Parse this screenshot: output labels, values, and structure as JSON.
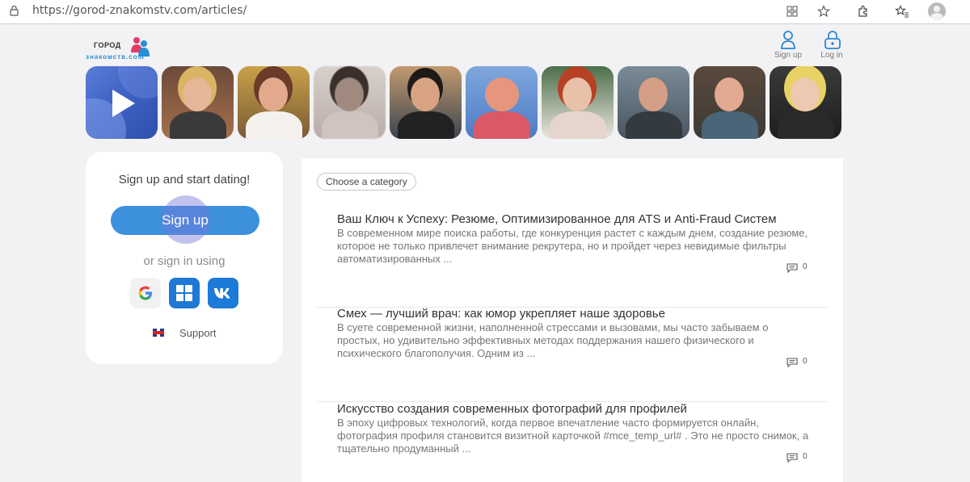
{
  "browser": {
    "url": "https://gorod-znakomstv.com/articles/"
  },
  "header": {
    "logo_top": "ГОРОД",
    "logo_bottom": "знакомств.com",
    "signup_label": "Sign up",
    "login_label": "Log in"
  },
  "sidebar": {
    "tagline": "Sign up and start dating!",
    "signup_button": "Sign up",
    "or_text": "or sign in using",
    "support_label": "Support"
  },
  "main": {
    "category_button": "Choose a category",
    "articles": [
      {
        "title": "Ваш Ключ к Успеху: Резюме, Оптимизированное для ATS и Anti-Fraud Систем",
        "excerpt": "В современном мире поиска работы, где конкуренция растет с каждым днем, создание резюме, которое не только привлечет внимание рекрутера, но и пройдет через невидимые фильтры автоматизированных ...",
        "comments": "0"
      },
      {
        "title": "Смех — лучший врач: как юмор укрепляет наше здоровье",
        "excerpt": "В суете современной жизни, наполненной стрессами и вызовами, мы часто забываем о простых, но удивительно эффективных методах поддержания нашего физического и психического благополучия. Одним из ...",
        "comments": "0"
      },
      {
        "title": "Искусство создания современных фотографий для профилей",
        "excerpt": "В эпоху цифровых технологий, когда первое впечатление часто формируется онлайн, фотография профиля становится визитной карточкой #mce_temp_url# . Это не просто снимок, а тщательно продуманный ...",
        "comments": "0"
      }
    ]
  },
  "colors": {
    "accent": "#3c90dc",
    "background": "#f2f2f4"
  }
}
